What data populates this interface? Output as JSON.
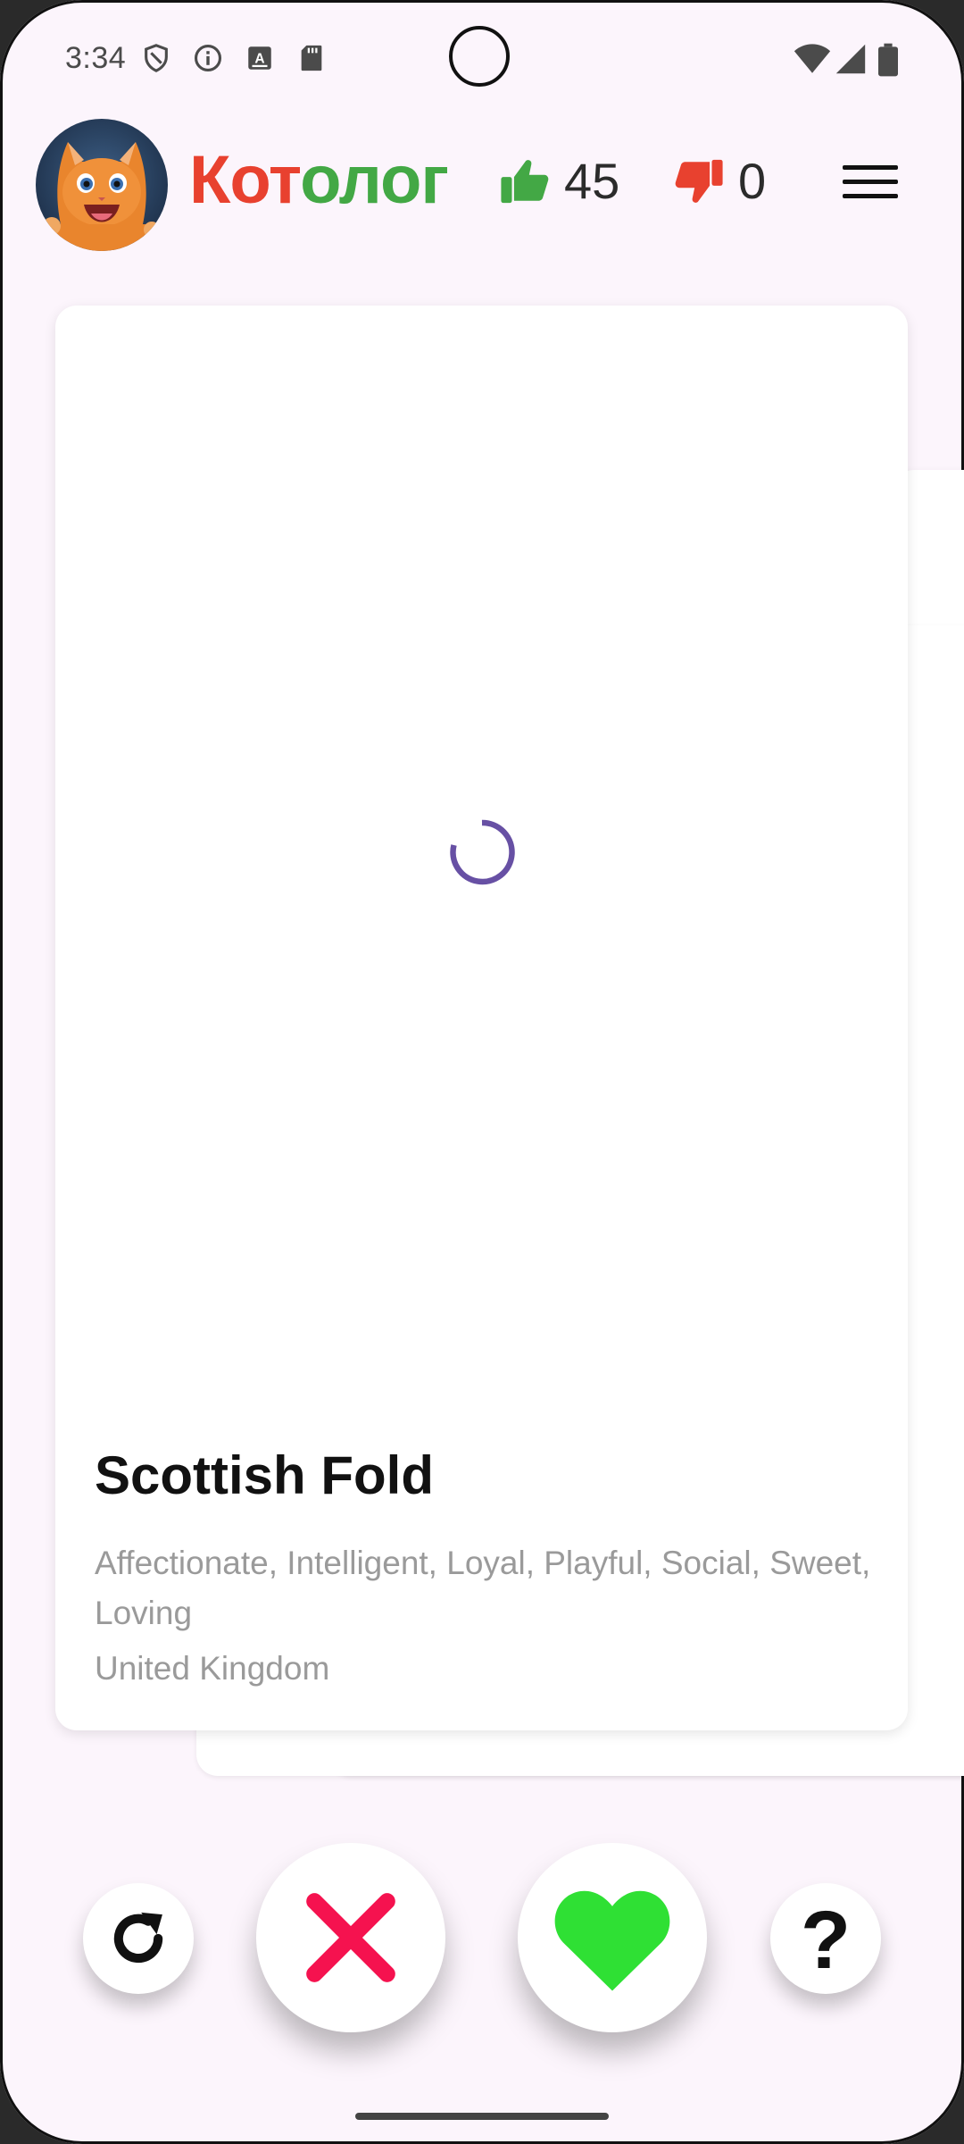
{
  "status_bar": {
    "time": "3:34",
    "left_icons": [
      "vpn-shield-icon",
      "info-icon",
      "text-app-icon",
      "sd-card-icon"
    ],
    "right_icons": [
      "wifi-icon",
      "signal-icon",
      "battery-icon"
    ]
  },
  "header": {
    "title_part1": "Кот",
    "title_part2": "олог",
    "likes_count": "45",
    "dislikes_count": "0",
    "colors": {
      "title_red": "#e8412f",
      "title_green": "#43a845",
      "like_green": "#43a845",
      "dislike_red": "#e8412f"
    }
  },
  "card": {
    "breed_name": "Scottish Fold",
    "temperament": "Affectionate, Intelligent, Loyal, Playful, Social, Sweet, Loving",
    "origin": "United Kingdom",
    "image_state": "loading"
  },
  "actions": {
    "undo_icon": "refresh-icon",
    "dislike_icon": "close-x-icon",
    "like_icon": "heart-icon",
    "help_icon": "question-icon",
    "help_glyph": "?",
    "colors": {
      "dislike": "#f5124f",
      "like": "#2fe034"
    }
  }
}
